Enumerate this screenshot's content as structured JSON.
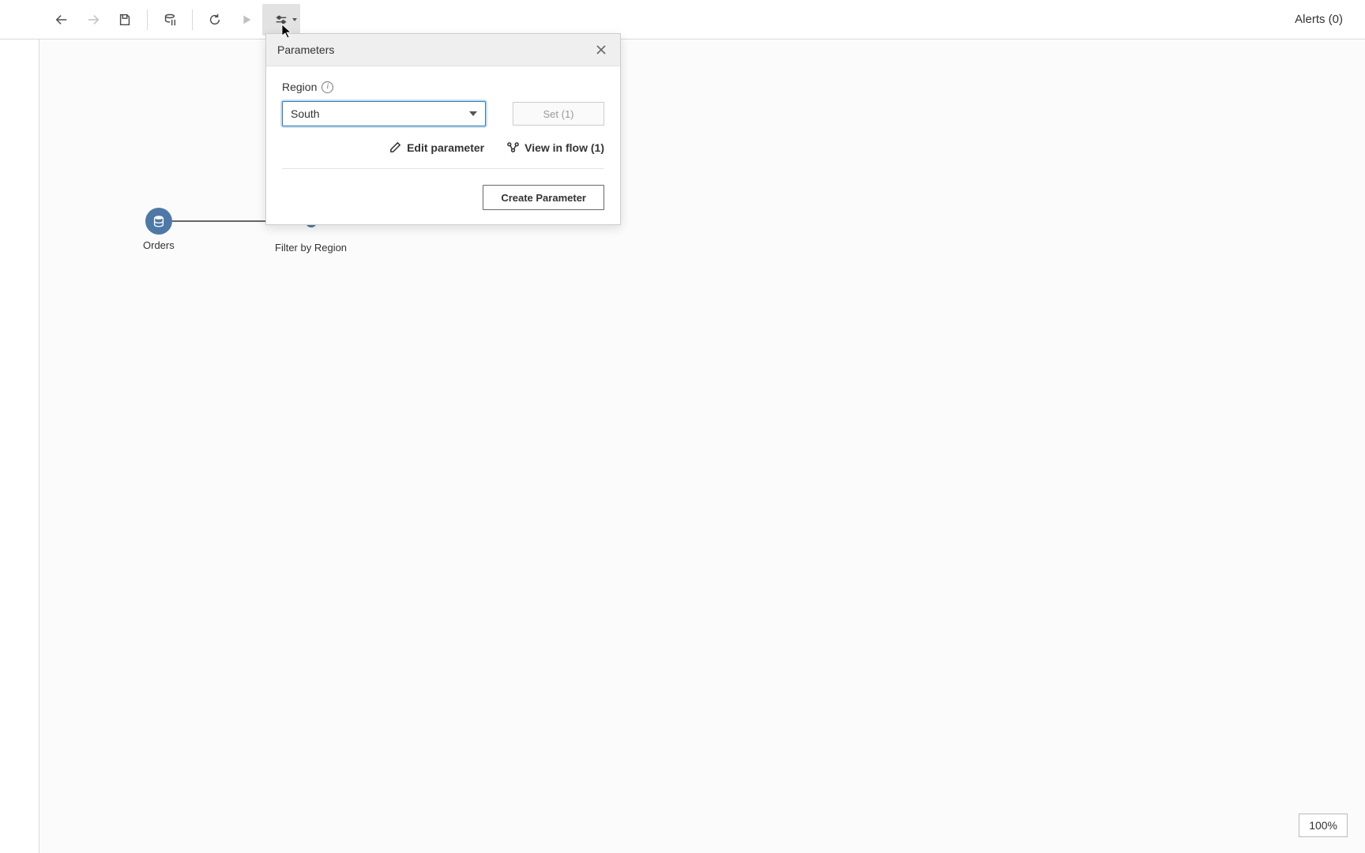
{
  "toolbar": {
    "alerts_label": "Alerts (0)"
  },
  "popup": {
    "title": "Parameters",
    "param_label": "Region",
    "dropdown_value": "South",
    "set_button_label": "Set (1)",
    "edit_label": "Edit parameter",
    "view_in_flow_label": "View in flow (1)",
    "create_label": "Create Parameter"
  },
  "nodes": {
    "orders_label": "Orders",
    "filter_label": "Filter by Region"
  },
  "zoom_label": "100%"
}
